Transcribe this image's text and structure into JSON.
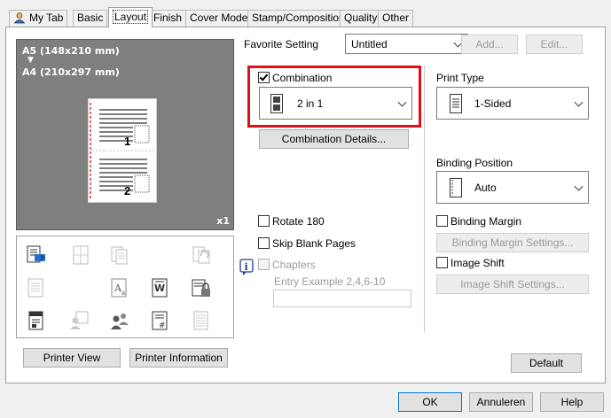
{
  "tabs": [
    {
      "label": "My Tab"
    },
    {
      "label": "Basic"
    },
    {
      "label": "Layout"
    },
    {
      "label": "Finish"
    },
    {
      "label": "Cover Mode"
    },
    {
      "label": "Stamp/Composition"
    },
    {
      "label": "Quality"
    },
    {
      "label": "Other"
    }
  ],
  "preview": {
    "source_size": "A5 (148x210 mm)",
    "arrow": "▼",
    "target_size": "A4 (210x297 mm)",
    "page1": "1",
    "page2": "2",
    "copies": "x1"
  },
  "favorite": {
    "label": "Favorite Setting",
    "value": "Untitled",
    "add_label": "Add...",
    "edit_label": "Edit..."
  },
  "combination": {
    "label": "Combination",
    "checked": true,
    "value": "2 in 1",
    "details_label": "Combination Details..."
  },
  "options": {
    "rotate_label": "Rotate 180",
    "skip_label": "Skip Blank Pages",
    "chapters_label": "Chapters",
    "entry_example": "Entry Example 2,4,6-10"
  },
  "print_type": {
    "label": "Print Type",
    "value": "1-Sided"
  },
  "binding": {
    "position_label": "Binding Position",
    "position_value": "Auto",
    "margin_label": "Binding Margin",
    "margin_settings_label": "Binding Margin Settings...",
    "image_shift_label": "Image Shift",
    "image_shift_settings_label": "Image Shift Settings..."
  },
  "bottom": {
    "printer_view": "Printer View",
    "printer_info": "Printer Information",
    "default": "Default",
    "ok": "OK",
    "cancel": "Annuleren",
    "help": "Help"
  },
  "colors": {
    "highlight": "#e0101a",
    "preview_bg": "#7f7f7f"
  }
}
